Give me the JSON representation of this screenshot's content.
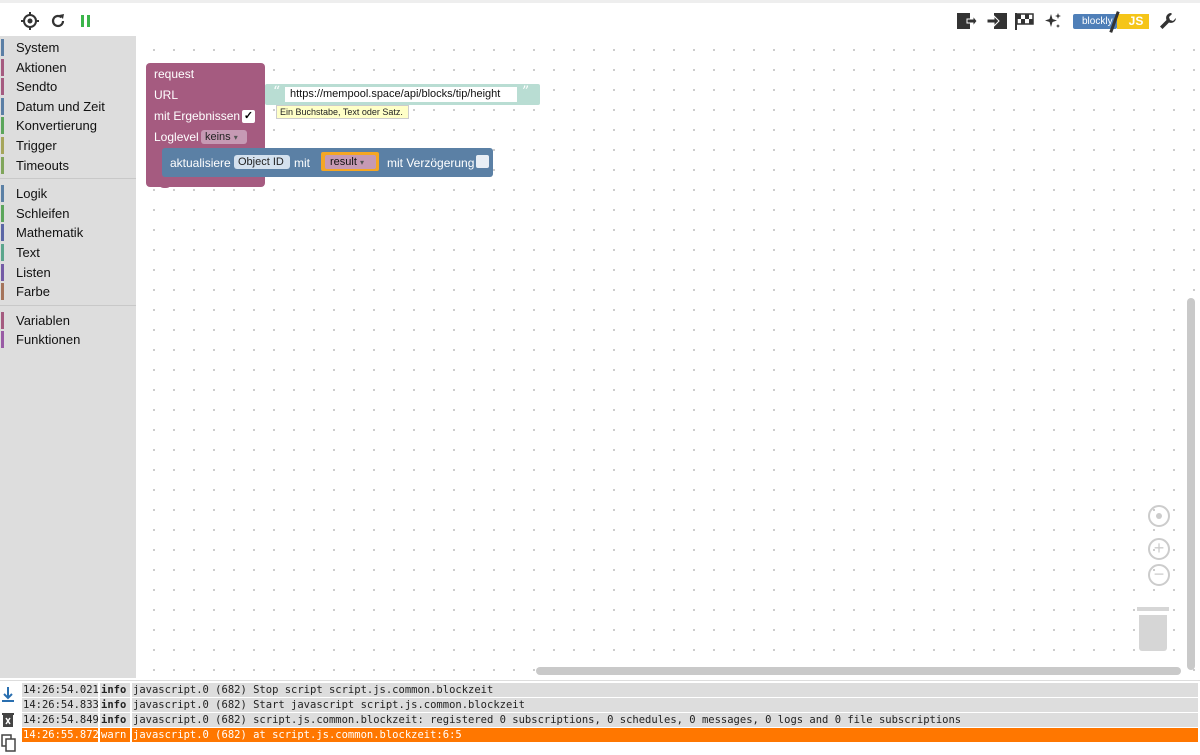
{
  "toolbar": {
    "left_icons": [
      "locate-icon",
      "reload-icon",
      "pause-icon"
    ],
    "right_icons": [
      "export-icon",
      "import-icon",
      "flag-icon",
      "sparkle-icon",
      "wrench-icon"
    ],
    "badge_left": "blockly",
    "badge_right": "JS",
    "colors": {
      "pause": "#3bb54a",
      "icon": "#333333"
    }
  },
  "sidebar": {
    "groups": [
      [
        {
          "label": "System",
          "color": "#5b7fa5"
        },
        {
          "label": "Aktionen",
          "color": "#a55b80"
        },
        {
          "label": "Sendto",
          "color": "#a55b80"
        },
        {
          "label": "Datum und Zeit",
          "color": "#5b7fa5"
        },
        {
          "label": "Konvertierung",
          "color": "#5ba55b"
        },
        {
          "label": "Trigger",
          "color": "#a5a55b"
        },
        {
          "label": "Timeouts",
          "color": "#80a55b"
        }
      ],
      [
        {
          "label": "Logik",
          "color": "#5b80a5"
        },
        {
          "label": "Schleifen",
          "color": "#5ba55b"
        },
        {
          "label": "Mathematik",
          "color": "#5b67a5"
        },
        {
          "label": "Text",
          "color": "#5ba58c"
        },
        {
          "label": "Listen",
          "color": "#745ba5"
        },
        {
          "label": "Farbe",
          "color": "#a5745b"
        }
      ],
      [
        {
          "label": "Variablen",
          "color": "#a55b80"
        },
        {
          "label": "Funktionen",
          "color": "#995ba5"
        }
      ]
    ]
  },
  "blocks": {
    "request": {
      "title": "request",
      "url_label": "URL",
      "results_label": "mit Ergebnissen",
      "results_checked": "✓",
      "loglevel_label": "Loglevel",
      "loglevel_value": "keins"
    },
    "string": {
      "value": "https://mempool.space/api/blocks/tip/height",
      "tooltip": "Ein Buchstabe, Text oder Satz."
    },
    "update": {
      "label": "aktualisiere",
      "object": "Object ID",
      "with": "mit",
      "variable": "result",
      "delay": "mit Verzögerung"
    }
  },
  "log": {
    "rows": [
      {
        "time": "14:26:54.021",
        "level": "info",
        "msg": "javascript.0 (682) Stop script script.js.common.blockzeit"
      },
      {
        "time": "14:26:54.833",
        "level": "info",
        "msg": "javascript.0 (682) Start javascript script.js.common.blockzeit"
      },
      {
        "time": "14:26:54.849",
        "level": "info",
        "msg": "javascript.0 (682) script.js.common.blockzeit: registered 0 subscriptions, 0 schedules, 0 messages, 0 logs and 0 file subscriptions"
      },
      {
        "time": "14:26:55.872",
        "level": "warn",
        "msg": "javascript.0 (682) at script.js.common.blockzeit:6:5"
      }
    ]
  }
}
